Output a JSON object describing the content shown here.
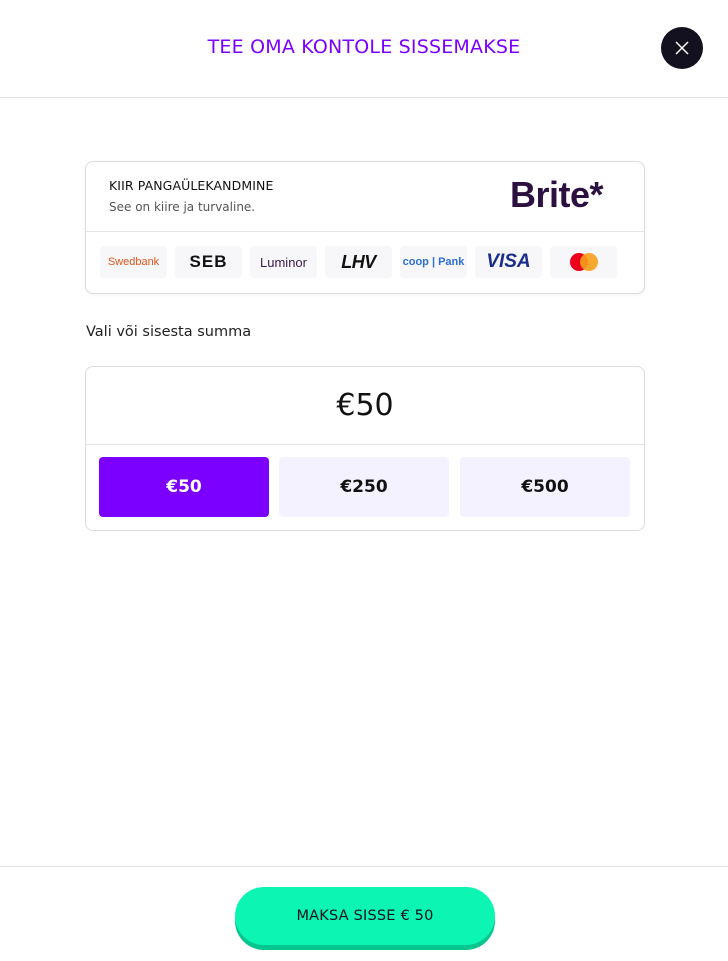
{
  "header": {
    "title": "TEE OMA KONTOLE SISSEMAKSE",
    "close_icon": "close-icon"
  },
  "provider": {
    "name": "KIIR PANGAÜLEKANDMINE",
    "description": "See on kiire ja turvaline.",
    "brand": "Brite*",
    "banks": [
      "Swedbank",
      "SEB",
      "Luminor",
      "LHV",
      "coop | Pank",
      "VISA",
      "mastercard"
    ]
  },
  "amount": {
    "label": "Vali või sisesta summa",
    "value": "€50",
    "options": [
      "€50",
      "€250",
      "€500"
    ],
    "selected_index": 0
  },
  "footer": {
    "pay_label": "MAKSA SISSE € 50"
  },
  "colors": {
    "accent": "#7b00ff",
    "pay_button": "#0cf5b3",
    "dark": "#13101f"
  }
}
